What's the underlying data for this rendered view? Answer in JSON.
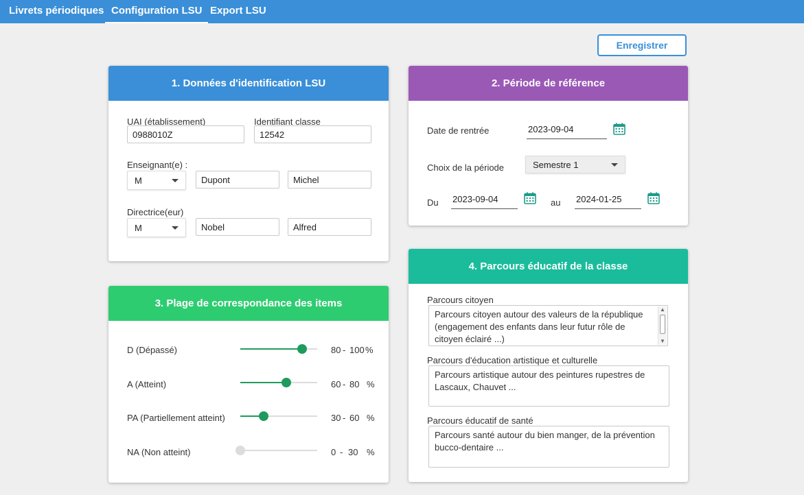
{
  "nav": {
    "tabs": [
      {
        "label": "Livrets périodiques"
      },
      {
        "label": "Configuration LSU"
      },
      {
        "label": "Export LSU"
      }
    ],
    "active_tab": "Configuration LSU"
  },
  "actions": {
    "save_label": "Enregistrer"
  },
  "colors": {
    "topbar": "#3a8fd8",
    "card1": "#3a8fd8",
    "card2": "#9b59b6",
    "card3": "#2ecc71",
    "card4": "#1abc9c",
    "slider": "#1e9b5c"
  },
  "identification": {
    "title": "1. Données d'identification LSU",
    "uai_label": "UAI (établissement)",
    "uai_value": "0988010Z",
    "class_id_label": "Identifiant classe",
    "class_id_value": "12542",
    "teacher_label": "Enseignant(e) :",
    "teacher_civility": "M",
    "teacher_lastname": "Dupont",
    "teacher_firstname": "Michel",
    "director_label": "Directrice(eur)",
    "director_civility": "M",
    "director_lastname": "Nobel",
    "director_firstname": "Alfred"
  },
  "period": {
    "title": "2. Période de référence",
    "start_label": "Date de rentrée",
    "start_value": "2023-09-04",
    "choice_label": "Choix de la période",
    "choice_value": "Semestre 1",
    "from_label": "Du",
    "from_value": "2023-09-04",
    "to_label": "au",
    "to_value": "2024-01-25",
    "calendar_icon": "calendar-icon"
  },
  "ranges": {
    "title": "3. Plage de correspondance des items",
    "items": [
      {
        "label": "D (Dépassé)",
        "low": "80",
        "sep": "-",
        "high": "100",
        "unit": "%",
        "level": 0.8,
        "enabled": true
      },
      {
        "label": "A (Atteint)",
        "low": "60",
        "sep": "-",
        "high": "80",
        "unit": "%",
        "level": 0.6,
        "enabled": true
      },
      {
        "label": "PA (Partiellement atteint)",
        "low": "30",
        "sep": "-",
        "high": "60",
        "unit": "%",
        "level": 0.3,
        "enabled": true
      },
      {
        "label": "NA (Non atteint)",
        "low": "0",
        "sep": "-",
        "high": "30",
        "unit": "%",
        "level": 0.0,
        "enabled": false
      }
    ]
  },
  "parcours": {
    "title": "4. Parcours éducatif de la classe",
    "citoyen_label": "Parcours citoyen",
    "citoyen_value": "Parcours citoyen autour des valeurs de la république (engagement des enfants dans leur futur rôle de citoyen éclairé ...)",
    "artistique_label": "Parcours d'éducation artistique et culturelle",
    "artistique_value": "Parcours artistique autour des peintures rupestres de Lascaux, Chauvet ...",
    "sante_label": "Parcours éducatif de santé",
    "sante_value": "Parcours santé autour du bien manger, de la prévention bucco-dentaire ..."
  }
}
